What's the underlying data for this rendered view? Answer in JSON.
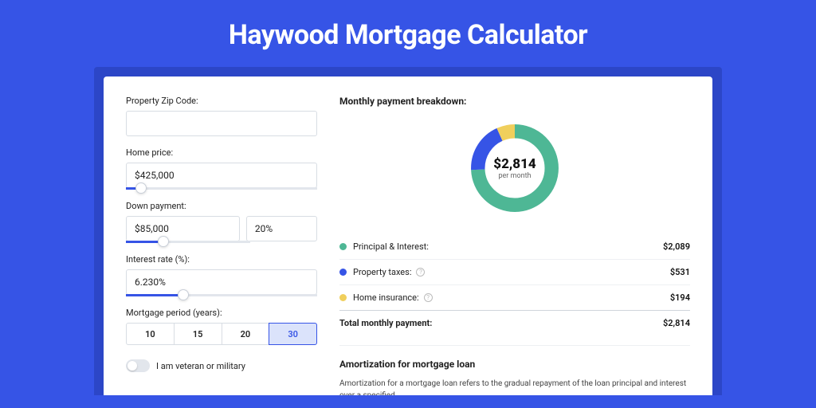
{
  "page_title": "Haywood Mortgage Calculator",
  "form": {
    "zip_label": "Property Zip Code:",
    "zip_value": "",
    "home_price_label": "Home price:",
    "home_price_value": "$425,000",
    "home_price_slider_pct": 8,
    "down_payment_label": "Down payment:",
    "down_payment_value": "$85,000",
    "down_payment_pct_value": "20%",
    "down_payment_slider_pct": 20,
    "interest_label": "Interest rate (%):",
    "interest_value": "6.230%",
    "interest_slider_pct": 30,
    "period_label": "Mortgage period (years):",
    "period_options": [
      "10",
      "15",
      "20",
      "30"
    ],
    "period_selected": "30",
    "veteran_label": "I am veteran or military"
  },
  "breakdown": {
    "title": "Monthly payment breakdown:",
    "donut_amount": "$2,814",
    "donut_sub": "per month",
    "items": [
      {
        "label": "Principal & Interest:",
        "value": "$2,089",
        "color": "#4eb795",
        "help": false
      },
      {
        "label": "Property taxes:",
        "value": "$531",
        "color": "#3654e6",
        "help": true
      },
      {
        "label": "Home insurance:",
        "value": "$194",
        "color": "#f0cf5c",
        "help": true
      }
    ],
    "total_label": "Total monthly payment:",
    "total_value": "$2,814"
  },
  "chart_data": {
    "type": "pie",
    "title": "Monthly payment breakdown",
    "series": [
      {
        "name": "Principal & Interest",
        "value": 2089,
        "color": "#4eb795"
      },
      {
        "name": "Property taxes",
        "value": 531,
        "color": "#3654e6"
      },
      {
        "name": "Home insurance",
        "value": 194,
        "color": "#f0cf5c"
      }
    ],
    "total": 2814,
    "center_label": "$2,814 per month"
  },
  "amortization": {
    "title": "Amortization for mortgage loan",
    "text": "Amortization for a mortgage loan refers to the gradual repayment of the loan principal and interest over a specified"
  }
}
